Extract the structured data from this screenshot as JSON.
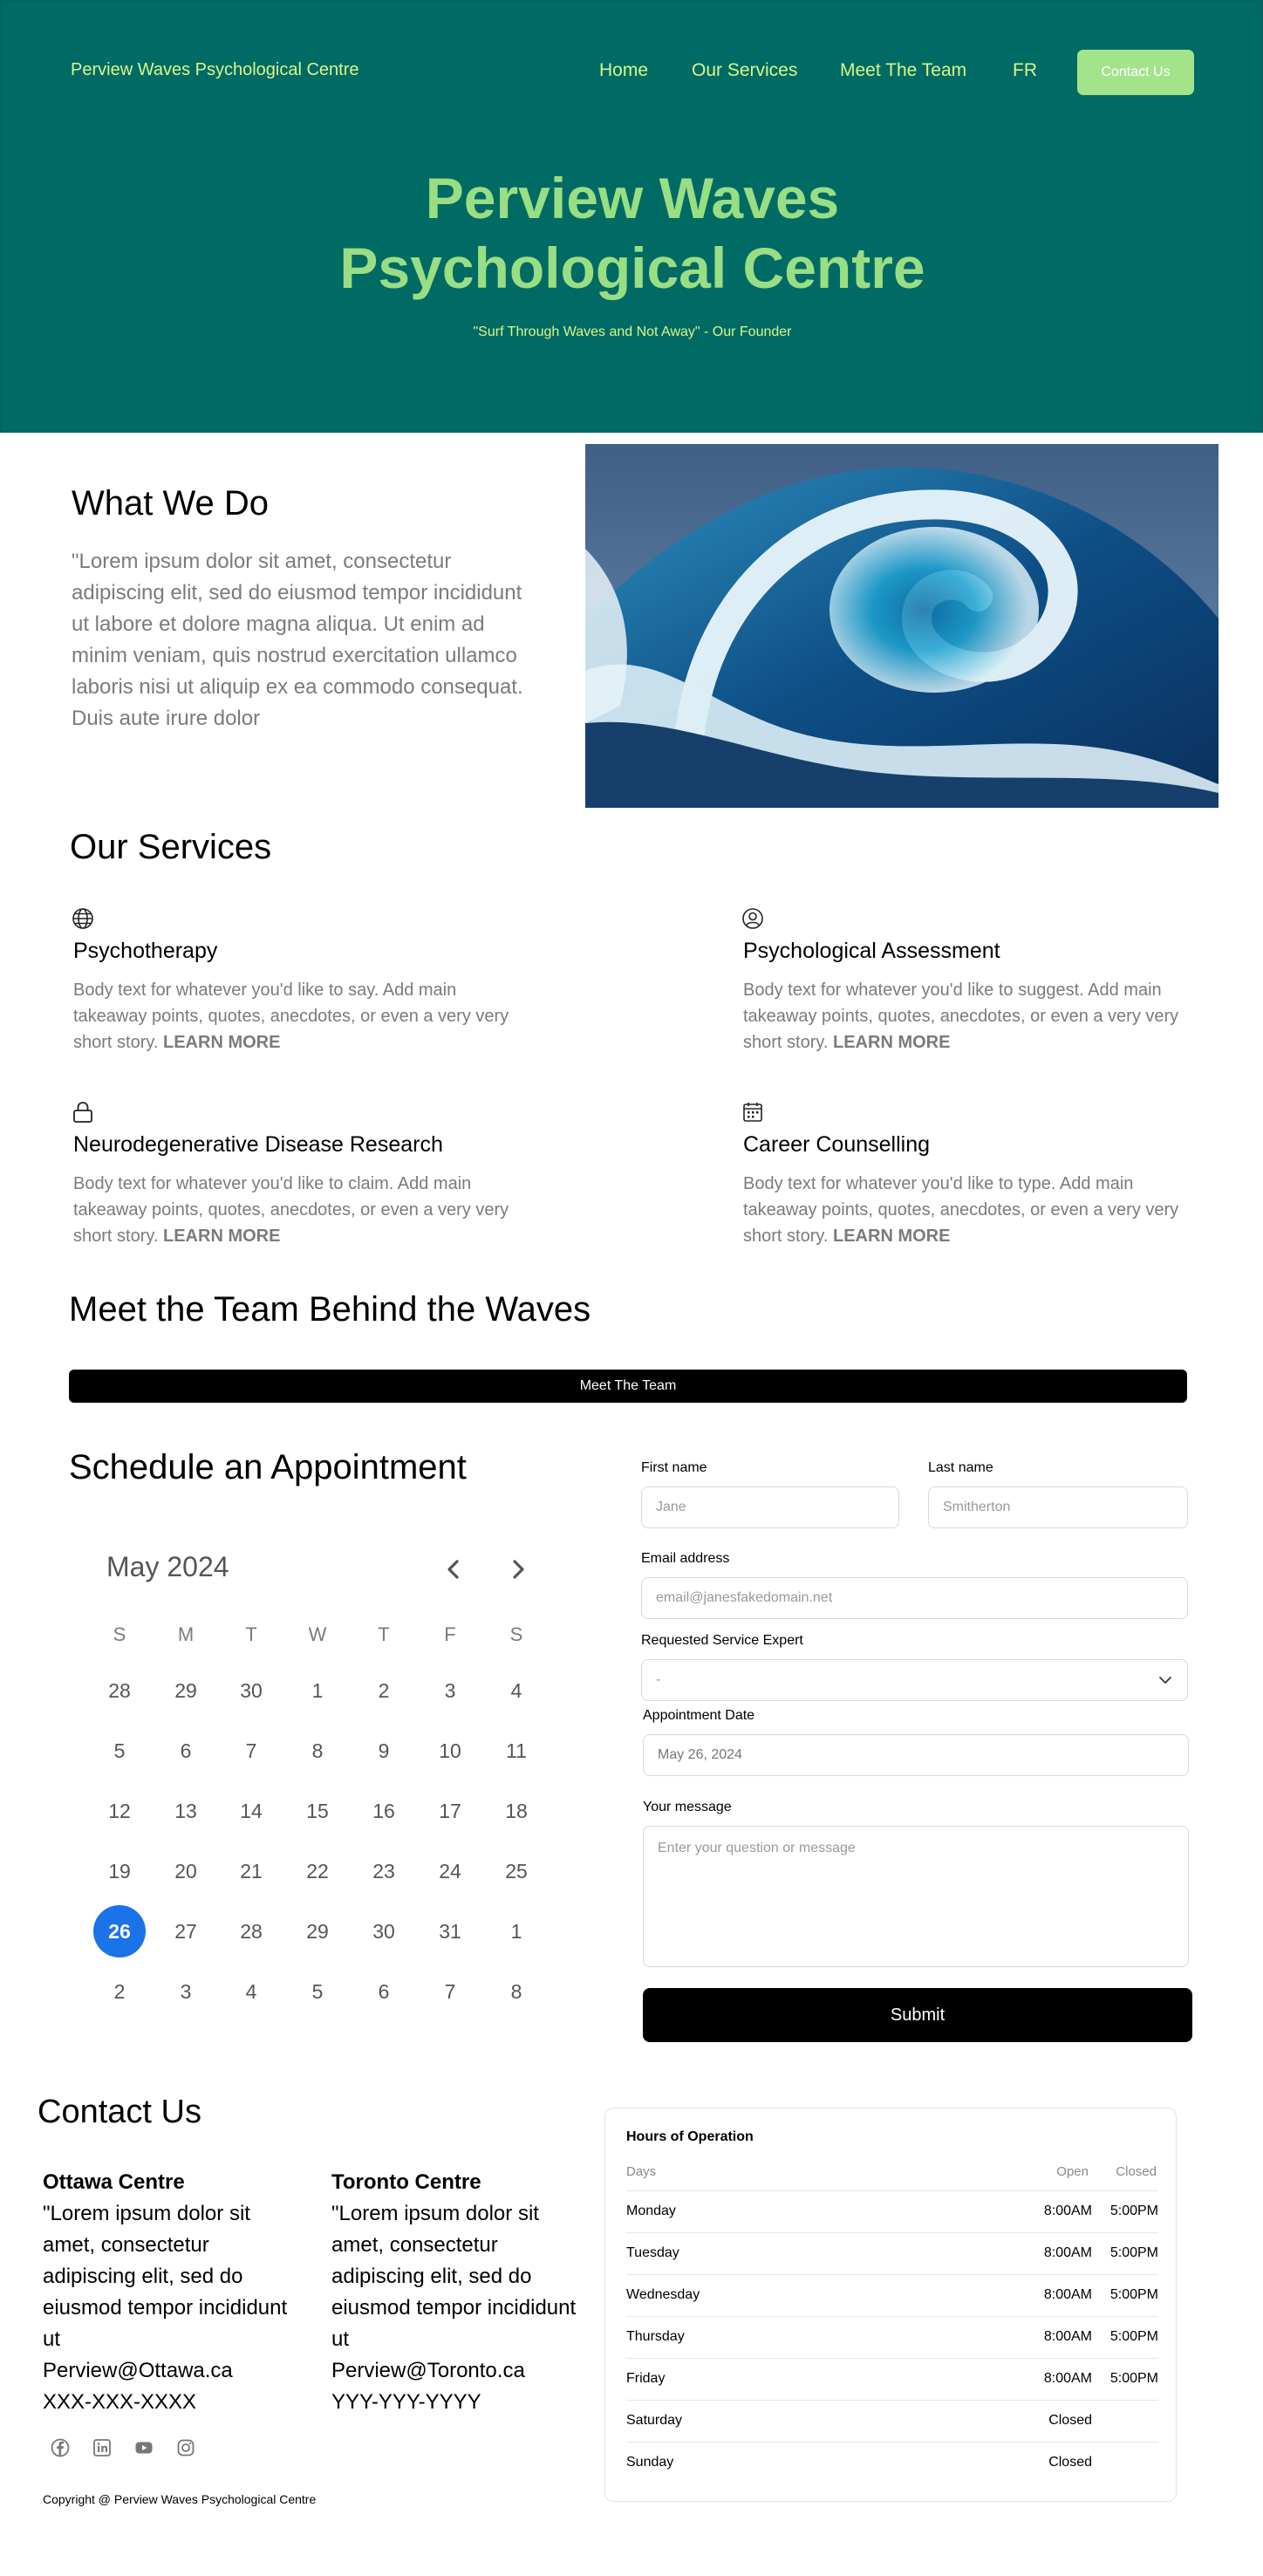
{
  "header": {
    "brand": "Perview Waves Psychological Centre",
    "nav": [
      "Home",
      "Our Services",
      "Meet The Team",
      "FR"
    ],
    "contact_button": "Contact Us"
  },
  "hero": {
    "title_line1": "Perview Waves",
    "title_line2": "Psychological Centre",
    "quote": "\"Surf Through Waves and Not Away\" - Our Founder"
  },
  "what_we_do": {
    "title": "What We Do",
    "body": "\"Lorem ipsum dolor sit amet, consectetur adipiscing elit, sed do eiusmod tempor incididunt ut labore et dolore magna aliqua. Ut enim ad minim veniam, quis nostrud exercitation ullamco laboris nisi ut aliquip ex ea commodo consequat. Duis aute irure dolor"
  },
  "services": {
    "title": "Our Services",
    "items": [
      {
        "icon": "globe-icon",
        "title": "Psychotherapy",
        "body": "Body text for whatever you'd like to say. Add main takeaway points, quotes, anecdotes, or even a very very short story.",
        "more": "LEARN MORE"
      },
      {
        "icon": "user-circle-icon",
        "title": "Psychological Assessment",
        "body": "Body text for whatever you'd like to suggest. Add main takeaway points, quotes, anecdotes, or even a very very short story.",
        "more": "LEARN MORE"
      },
      {
        "icon": "lock-icon",
        "title": "Neurodegenerative Disease Research",
        "body": "Body text for whatever you'd like to claim. Add main takeaway points, quotes, anecdotes, or even a very very short story.",
        "more": "LEARN MORE"
      },
      {
        "icon": "calendar-icon",
        "title": "Career Counselling",
        "body": "Body text for whatever you'd like to type. Add main takeaway points, quotes, anecdotes, or even a very very short story.",
        "more": "LEARN MORE"
      }
    ]
  },
  "team": {
    "title": "Meet the Team Behind the Waves",
    "button": "Meet The Team"
  },
  "appointment": {
    "title": "Schedule an Appointment",
    "calendar": {
      "month": "May 2024",
      "weekdays": [
        "S",
        "M",
        "T",
        "W",
        "T",
        "F",
        "S"
      ],
      "weeks": [
        [
          "28",
          "29",
          "30",
          "1",
          "2",
          "3",
          "4"
        ],
        [
          "5",
          "6",
          "7",
          "8",
          "9",
          "10",
          "11"
        ],
        [
          "12",
          "13",
          "14",
          "15",
          "16",
          "17",
          "18"
        ],
        [
          "19",
          "20",
          "21",
          "22",
          "23",
          "24",
          "25"
        ],
        [
          "26",
          "27",
          "28",
          "29",
          "30",
          "31",
          "1"
        ],
        [
          "2",
          "3",
          "4",
          "5",
          "6",
          "7",
          "8"
        ]
      ],
      "selected": "26"
    },
    "form": {
      "first_name_label": "First name",
      "first_name_placeholder": "Jane",
      "last_name_label": "Last name",
      "last_name_placeholder": "Smitherton",
      "email_label": "Email address",
      "email_placeholder": "email@janesfakedomain.net",
      "service_label": "Requested Service Expert",
      "service_value": "-",
      "date_label": "Appointment Date",
      "date_value": "May 26, 2024",
      "message_label": "Your message",
      "message_placeholder": "Enter your question or message",
      "submit": "Submit"
    }
  },
  "contact": {
    "title": "Contact Us",
    "locations": [
      {
        "name": "Ottawa Centre",
        "text": "\"Lorem ipsum dolor sit amet, consectetur adipiscing elit, sed do eiusmod tempor incididunt ut",
        "email": "Perview@Ottawa.ca",
        "phone": "XXX-XXX-XXXX"
      },
      {
        "name": "Toronto Centre",
        "text": "\"Lorem ipsum dolor sit amet, consectetur adipiscing elit, sed do eiusmod tempor incididunt ut",
        "email": "Perview@Toronto.ca",
        "phone": "YYY-YYY-YYYY"
      }
    ],
    "social_icons": [
      "facebook-icon",
      "linkedin-icon",
      "youtube-icon",
      "instagram-icon"
    ],
    "copyright": "Copyright @ Perview Waves Psychological Centre"
  },
  "hours": {
    "title": "Hours of Operation",
    "headers": {
      "days": "Days",
      "open": "Open",
      "closed": "Closed"
    },
    "rows": [
      {
        "day": "Monday",
        "open": "8:00AM",
        "close": "5:00PM"
      },
      {
        "day": "Tuesday",
        "open": "8:00AM",
        "close": "5:00PM"
      },
      {
        "day": "Wednesday",
        "open": "8:00AM",
        "close": "5:00PM"
      },
      {
        "day": "Thursday",
        "open": "8:00AM",
        "close": "5:00PM"
      },
      {
        "day": "Friday",
        "open": "8:00AM",
        "close": "5:00PM"
      },
      {
        "day": "Saturday",
        "status": "Closed"
      },
      {
        "day": "Sunday",
        "status": "Closed"
      }
    ]
  },
  "colors": {
    "hero_bg": "#006b64",
    "hero_title": "#9ade84",
    "nav_text": "#d9f58a",
    "contact_button_bg": "#a3e38a",
    "selected_date": "#1a73e8"
  }
}
